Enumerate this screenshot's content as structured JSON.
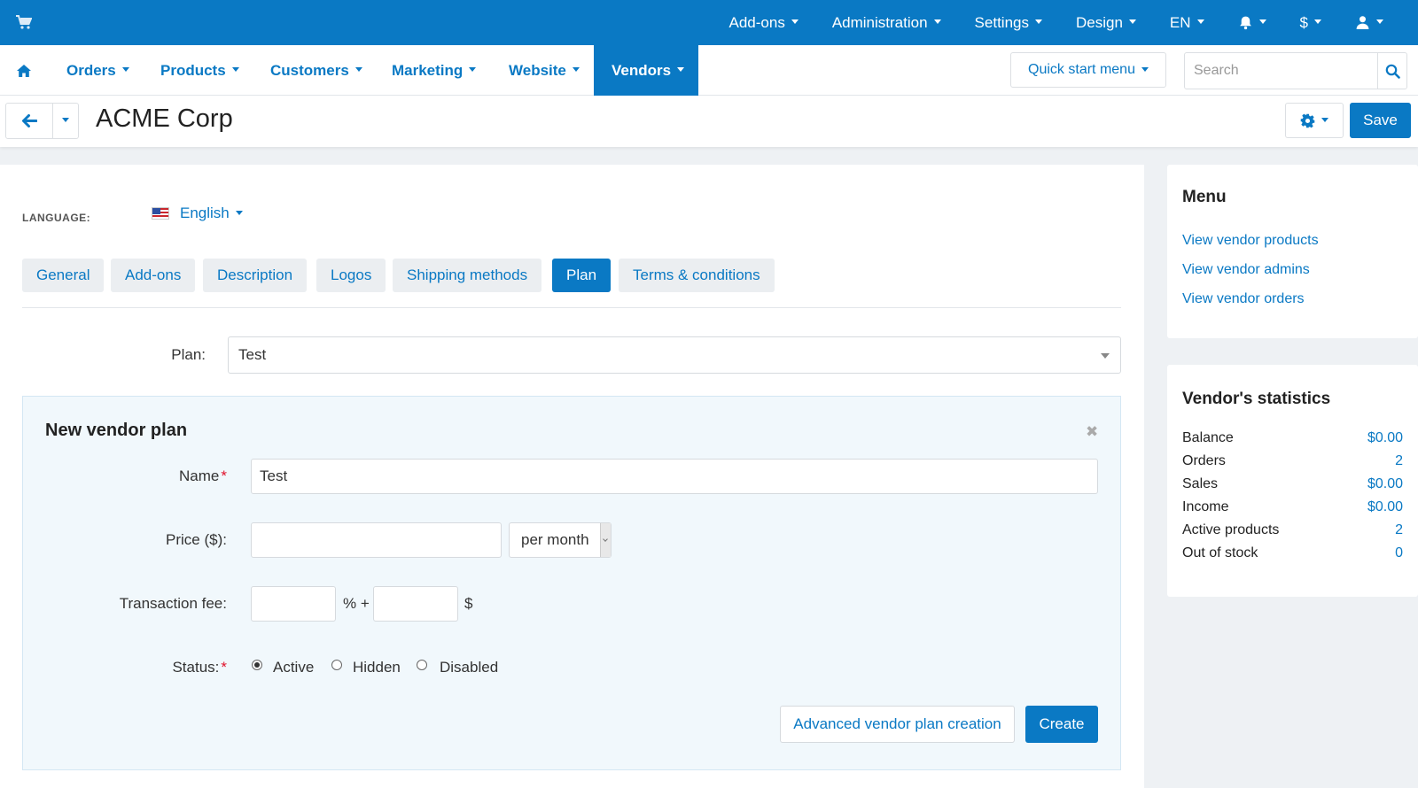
{
  "topbar": {
    "items": [
      {
        "label": "Add-ons"
      },
      {
        "label": "Administration"
      },
      {
        "label": "Settings"
      },
      {
        "label": "Design"
      },
      {
        "label": "EN"
      },
      {
        "label": "$"
      }
    ]
  },
  "mainnav": {
    "items": [
      {
        "label": "Orders"
      },
      {
        "label": "Products"
      },
      {
        "label": "Customers"
      },
      {
        "label": "Marketing"
      },
      {
        "label": "Website"
      },
      {
        "label": "Vendors"
      }
    ],
    "active": "Vendors",
    "quick_start_label": "Quick start menu",
    "search_placeholder": "Search"
  },
  "titlebar": {
    "title": "ACME Corp",
    "save_label": "Save"
  },
  "content": {
    "language_label": "LANGUAGE:",
    "language_value": "English",
    "tabs": [
      {
        "label": "General"
      },
      {
        "label": "Add-ons"
      },
      {
        "label": "Description"
      },
      {
        "label": "Logos"
      },
      {
        "label": "Shipping methods"
      },
      {
        "label": "Plan"
      },
      {
        "label": "Terms & conditions"
      }
    ],
    "active_tab": "Plan",
    "plan_label": "Plan:",
    "plan_value": "Test"
  },
  "new_plan": {
    "title": "New vendor plan",
    "close_glyph": "✖",
    "name_label": "Name",
    "name_value": "Test",
    "price_label": "Price ($):",
    "price_value": "",
    "period_value": "per month",
    "fee_label": "Transaction fee:",
    "fee_percent_value": "",
    "fee_percent_suffix": "% +",
    "fee_fixed_value": "",
    "fee_fixed_suffix": "$",
    "status_label": "Status:",
    "required_mark": "*",
    "status_options": [
      {
        "label": "Active",
        "checked": true
      },
      {
        "label": "Hidden",
        "checked": false
      },
      {
        "label": "Disabled",
        "checked": false
      }
    ],
    "advanced_label": "Advanced vendor plan creation",
    "create_label": "Create"
  },
  "sidebar": {
    "menu_title": "Menu",
    "menu_links": [
      {
        "label": "View vendor products"
      },
      {
        "label": "View vendor admins"
      },
      {
        "label": "View vendor orders"
      }
    ],
    "stats_title": "Vendor's statistics",
    "stats": [
      {
        "label": "Balance",
        "value": "$0.00"
      },
      {
        "label": "Orders",
        "value": "2"
      },
      {
        "label": "Sales",
        "value": "$0.00"
      },
      {
        "label": "Income",
        "value": "$0.00"
      },
      {
        "label": "Active products",
        "value": "2"
      },
      {
        "label": "Out of stock",
        "value": "0"
      }
    ]
  },
  "colors": {
    "accent": "#0a79c4",
    "required": "#e0112a",
    "panel_tint": "#f1f8fc"
  }
}
